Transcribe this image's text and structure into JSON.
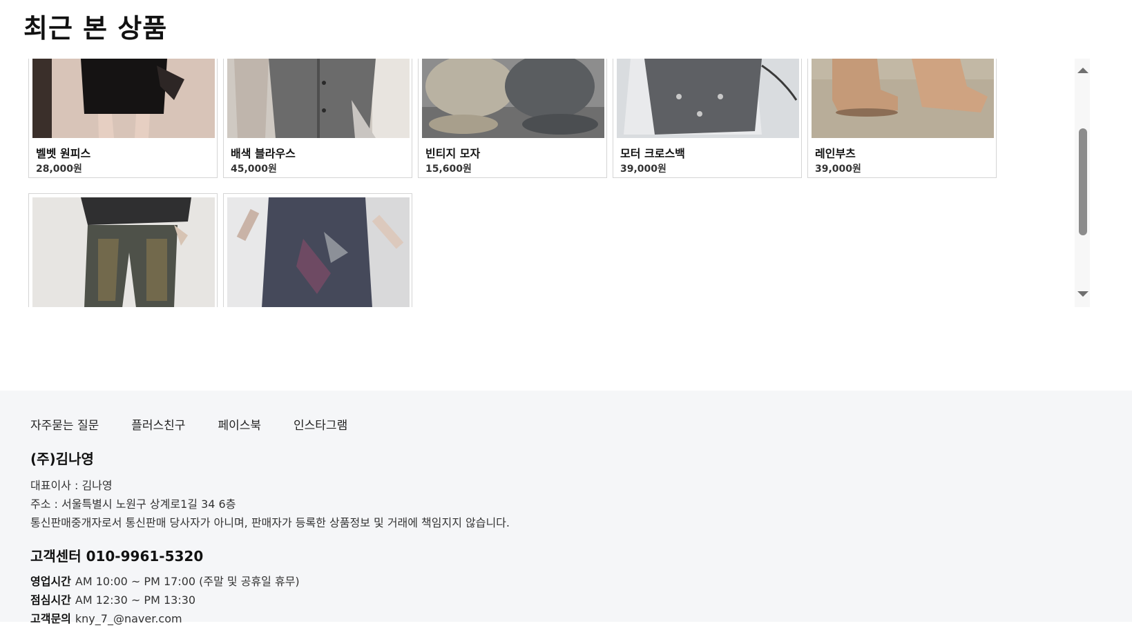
{
  "page_title": "최근 본 상품",
  "products": [
    {
      "name": "벨벳 원피스",
      "price": "28,000원"
    },
    {
      "name": "배색 블라우스",
      "price": "45,000원"
    },
    {
      "name": "빈티지 모자",
      "price": "15,600원"
    },
    {
      "name": "모터 크로스백",
      "price": "39,000원"
    },
    {
      "name": "레인부츠",
      "price": "39,000원"
    }
  ],
  "footer": {
    "links": [
      "자주묻는 질문",
      "플러스친구",
      "페이스북",
      "인스타그램"
    ],
    "company": "(주)김나영",
    "ceo": "대표이사 : 김나영",
    "address": "주소 : 서울특별시 노원구 상계로1길 34 6층",
    "disclaimer": "통신판매중개자로서 통신판매 당사자가 아니며, 판매자가 등록한 상품정보 및 거래에 책임지지 않습니다.",
    "cs_title": "고객센터 010-9961-5320",
    "hours_label": "영업시간",
    "hours": "AM 10:00 ~ PM 17:00 (주말 및 공휴일 휴무)",
    "lunch_label": "점심시간",
    "lunch": "AM 12:30 ~ PM 13:30",
    "inquiry_label": "고객문의",
    "inquiry": "kny_7_@naver.com"
  }
}
